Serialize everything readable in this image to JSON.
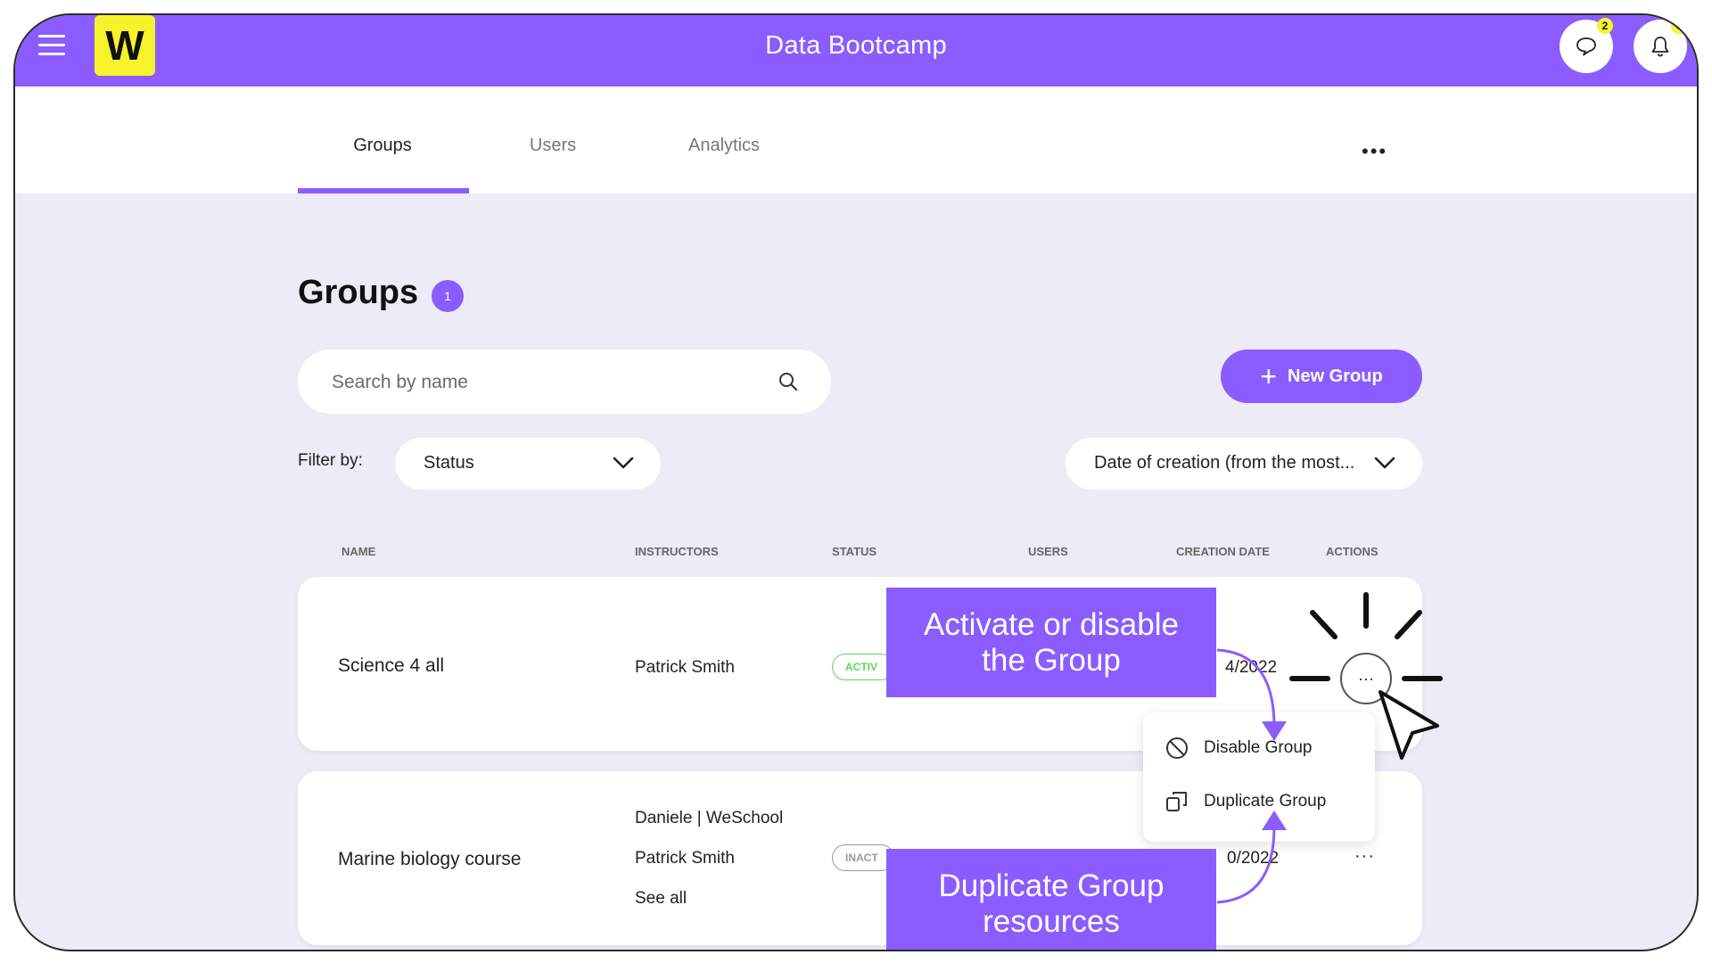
{
  "topbar": {
    "logo_letter": "W",
    "title": "Data Bootcamp",
    "chat_count": "2",
    "notif_count": "6"
  },
  "tabs": [
    {
      "label": "Groups",
      "active": true
    },
    {
      "label": "Users",
      "active": false
    },
    {
      "label": "Analytics",
      "active": false
    }
  ],
  "tabs_more": "•••",
  "page": {
    "title": "Groups",
    "count": "1"
  },
  "search": {
    "placeholder": "Search by name",
    "value": ""
  },
  "new_group_label": "New Group",
  "new_group_icon": "+",
  "filter": {
    "label": "Filter by:",
    "status_value": "Status",
    "sort_value": "Date of creation (from the most..."
  },
  "table": {
    "headers": [
      "NAME",
      "INSTRUCTORS",
      "STATUS",
      "USERS",
      "CREATION DATE",
      "ACTIONS"
    ],
    "rows": [
      {
        "name": "Science 4 all",
        "instructors": [
          "Patrick Smith"
        ],
        "status": "ACTIV",
        "date": "4/2022",
        "action": "···"
      },
      {
        "name": "Marine biology course",
        "instructors": [
          "Daniele | WeSchool",
          "Patrick Smith"
        ],
        "see_all": "See all",
        "status": "INACT",
        "date": "0/2022",
        "action": "···"
      }
    ]
  },
  "actions_menu": {
    "items": [
      {
        "label": "Disable Group",
        "icon": "ban-icon"
      },
      {
        "label": "Duplicate Group",
        "icon": "duplicate-icon"
      }
    ]
  },
  "callouts": {
    "top": [
      "Activate or disable",
      "the Group"
    ],
    "bottom": [
      "Duplicate Group",
      "resources"
    ]
  },
  "colors": {
    "brand": "#8b5cff",
    "logo": "#f6f32b",
    "background": "#ecebf6",
    "active_status": "#5cd65c",
    "inactive_status": "#9a9a9a"
  }
}
